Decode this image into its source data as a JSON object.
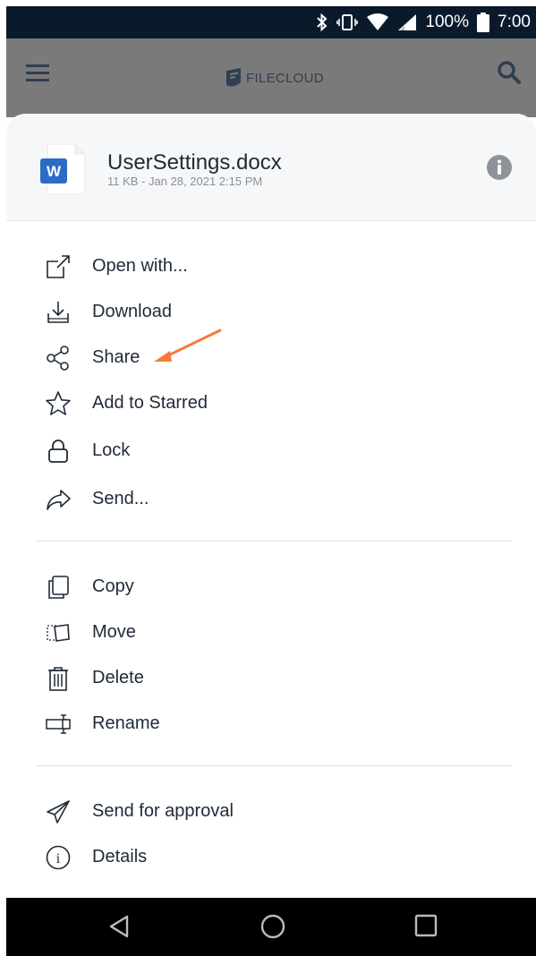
{
  "status_bar": {
    "battery": "100%",
    "time": "7:00"
  },
  "header": {
    "logo_text": "FILECLOUD"
  },
  "file": {
    "name": "UserSettings.docx",
    "meta": "11 KB - Jan 28, 2021 2:15 PM",
    "badge": "W"
  },
  "menu": {
    "group1": [
      {
        "label": "Open with...",
        "icon": "open-with-icon"
      },
      {
        "label": "Download",
        "icon": "download-icon"
      },
      {
        "label": "Share",
        "icon": "share-icon"
      },
      {
        "label": "Add to Starred",
        "icon": "star-icon"
      },
      {
        "label": "Lock",
        "icon": "lock-icon"
      },
      {
        "label": "Send...",
        "icon": "send-icon"
      }
    ],
    "group2": [
      {
        "label": "Copy",
        "icon": "copy-icon"
      },
      {
        "label": "Move",
        "icon": "move-icon"
      },
      {
        "label": "Delete",
        "icon": "trash-icon"
      },
      {
        "label": "Rename",
        "icon": "rename-icon"
      }
    ],
    "group3": [
      {
        "label": "Send for approval",
        "icon": "paper-plane-icon"
      },
      {
        "label": "Details",
        "icon": "info-circle-icon"
      }
    ]
  },
  "colors": {
    "header_bg": "#7a7a7a",
    "status_bg": "#0b1a2b",
    "word_blue": "#2b6cc4",
    "arrow": "#f47c3c"
  }
}
